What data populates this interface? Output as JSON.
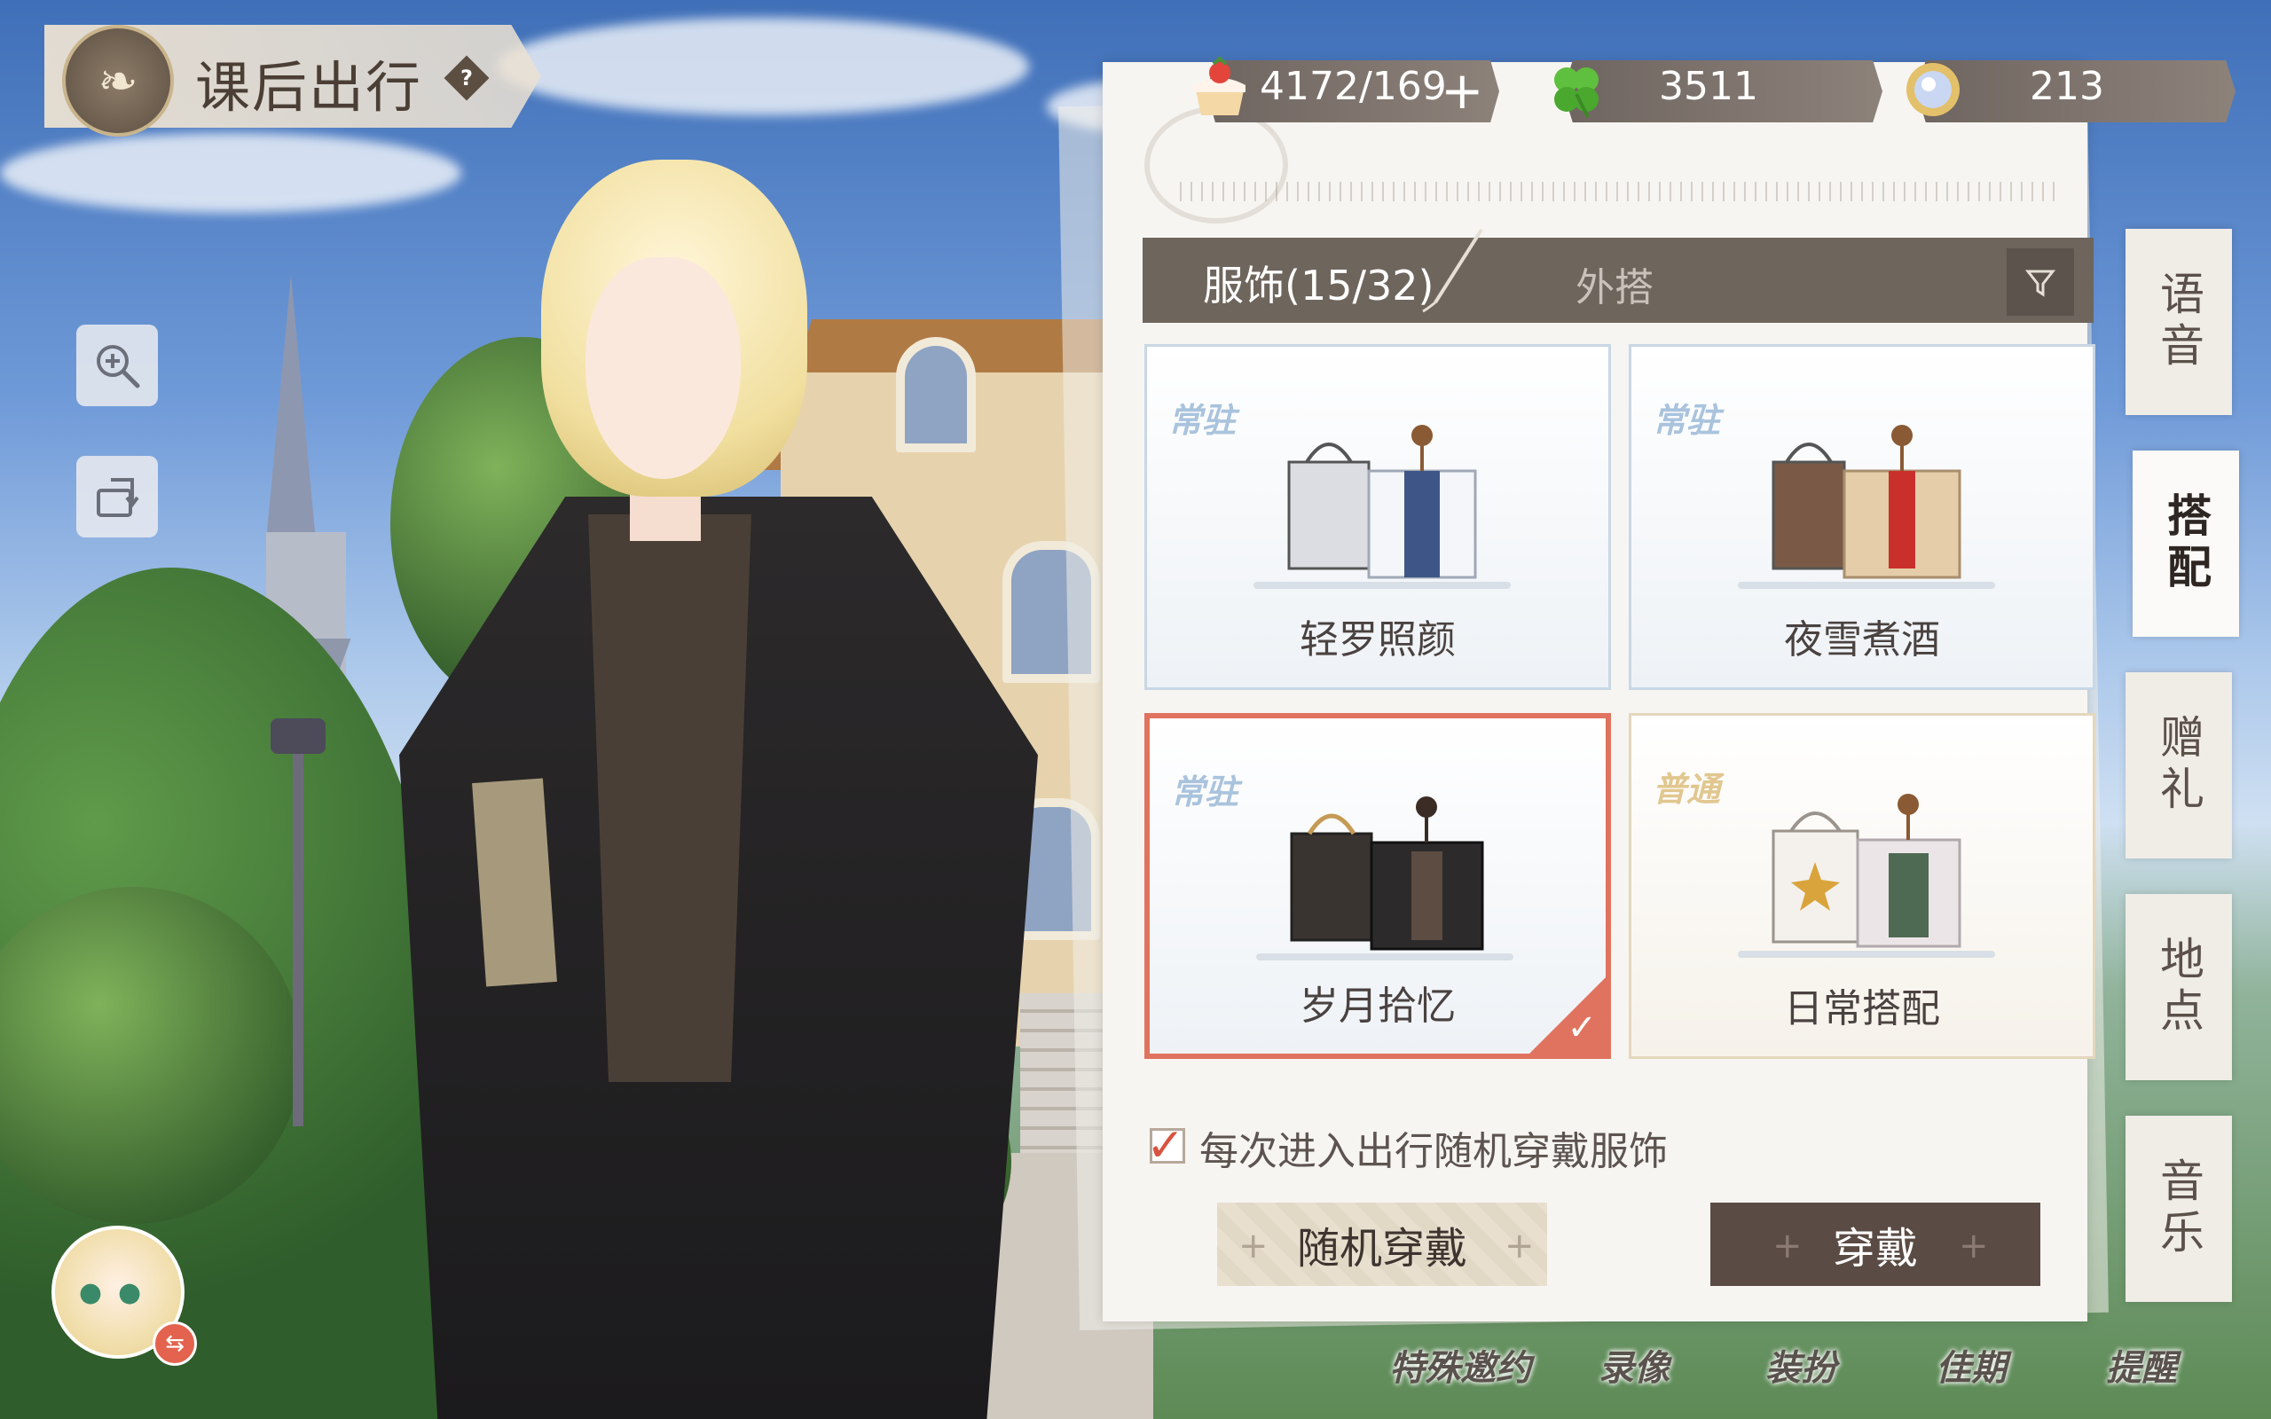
{
  "title": {
    "text": "课后出行",
    "help": "?"
  },
  "currency": [
    {
      "icon": "cake-icon",
      "value": "4172/169"
    },
    {
      "icon": "clover-icon",
      "value": "3511"
    },
    {
      "icon": "gem-icon",
      "value": "213"
    }
  ],
  "outfits": {
    "category_label": "服饰(15/32)",
    "filter_text": "外搭",
    "cards": [
      {
        "tag": "常驻",
        "name": "轻罗照颜",
        "selected": false
      },
      {
        "tag": "常驻",
        "name": "夜雪煮酒",
        "selected": false
      },
      {
        "tag": "常驻",
        "name": "岁月拾忆",
        "selected": true
      },
      {
        "tag": "普通",
        "name": "日常搭配",
        "selected": false
      }
    ],
    "random_checkbox": {
      "label": "每次进入出行随机穿戴服饰",
      "checked": true
    },
    "random_button": "随机穿戴",
    "wear_button": "穿戴"
  },
  "side_tabs": [
    {
      "label": "语音",
      "active": false
    },
    {
      "label": "搭配",
      "active": true
    },
    {
      "label": "赠礼",
      "active": false
    },
    {
      "label": "地点",
      "active": false
    },
    {
      "label": "音乐",
      "active": false
    }
  ],
  "bottom_nav": [
    "特殊邀约",
    "录像",
    "装扮",
    "佳期",
    "提醒"
  ],
  "colors": {
    "accent": "#e0735f",
    "panel": "#f7f5f2",
    "dark_bar": "#6e655d"
  }
}
